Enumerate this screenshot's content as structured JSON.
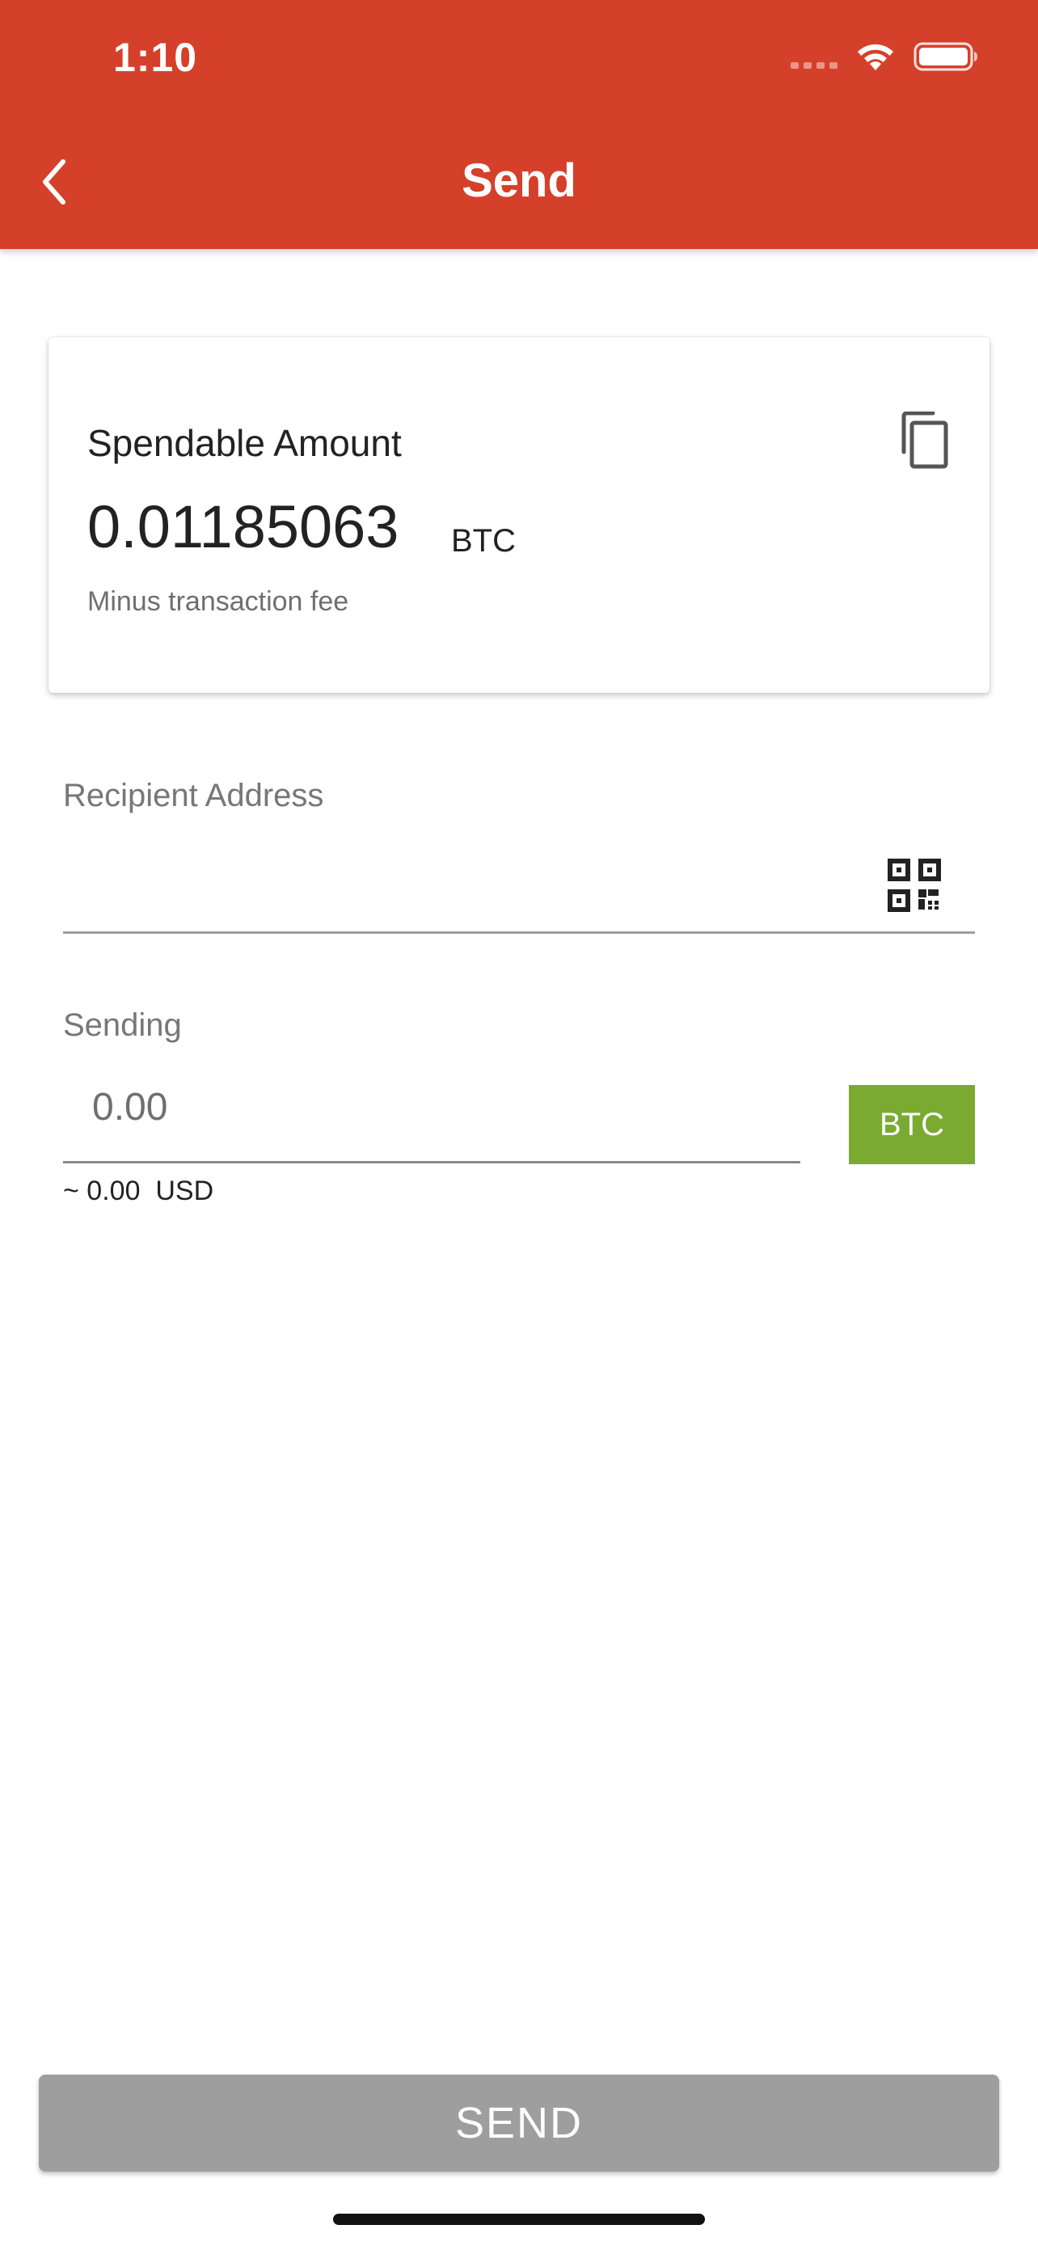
{
  "status_bar": {
    "time": "1:10",
    "icons": [
      "signal-dots-icon",
      "wifi-icon",
      "battery-icon"
    ]
  },
  "header": {
    "title": "Send",
    "back_icon": "chevron-left-icon",
    "background_color": "#D5402B"
  },
  "amount_card": {
    "label": "Spendable Amount",
    "amount": "0.01185063",
    "unit": "BTC",
    "note": "Minus transaction fee",
    "action_icon": "copy-icon"
  },
  "recipient": {
    "label": "Recipient Address",
    "value": "",
    "action_icon": "qr-code-icon"
  },
  "sending": {
    "label": "Sending",
    "placeholder": "0.00",
    "currency_button": "BTC",
    "currency_button_color": "#7BAA31",
    "approx_usd": "~ 0.00  USD"
  },
  "footer": {
    "send_label": "SEND",
    "send_button_color": "#9E9E9E"
  }
}
